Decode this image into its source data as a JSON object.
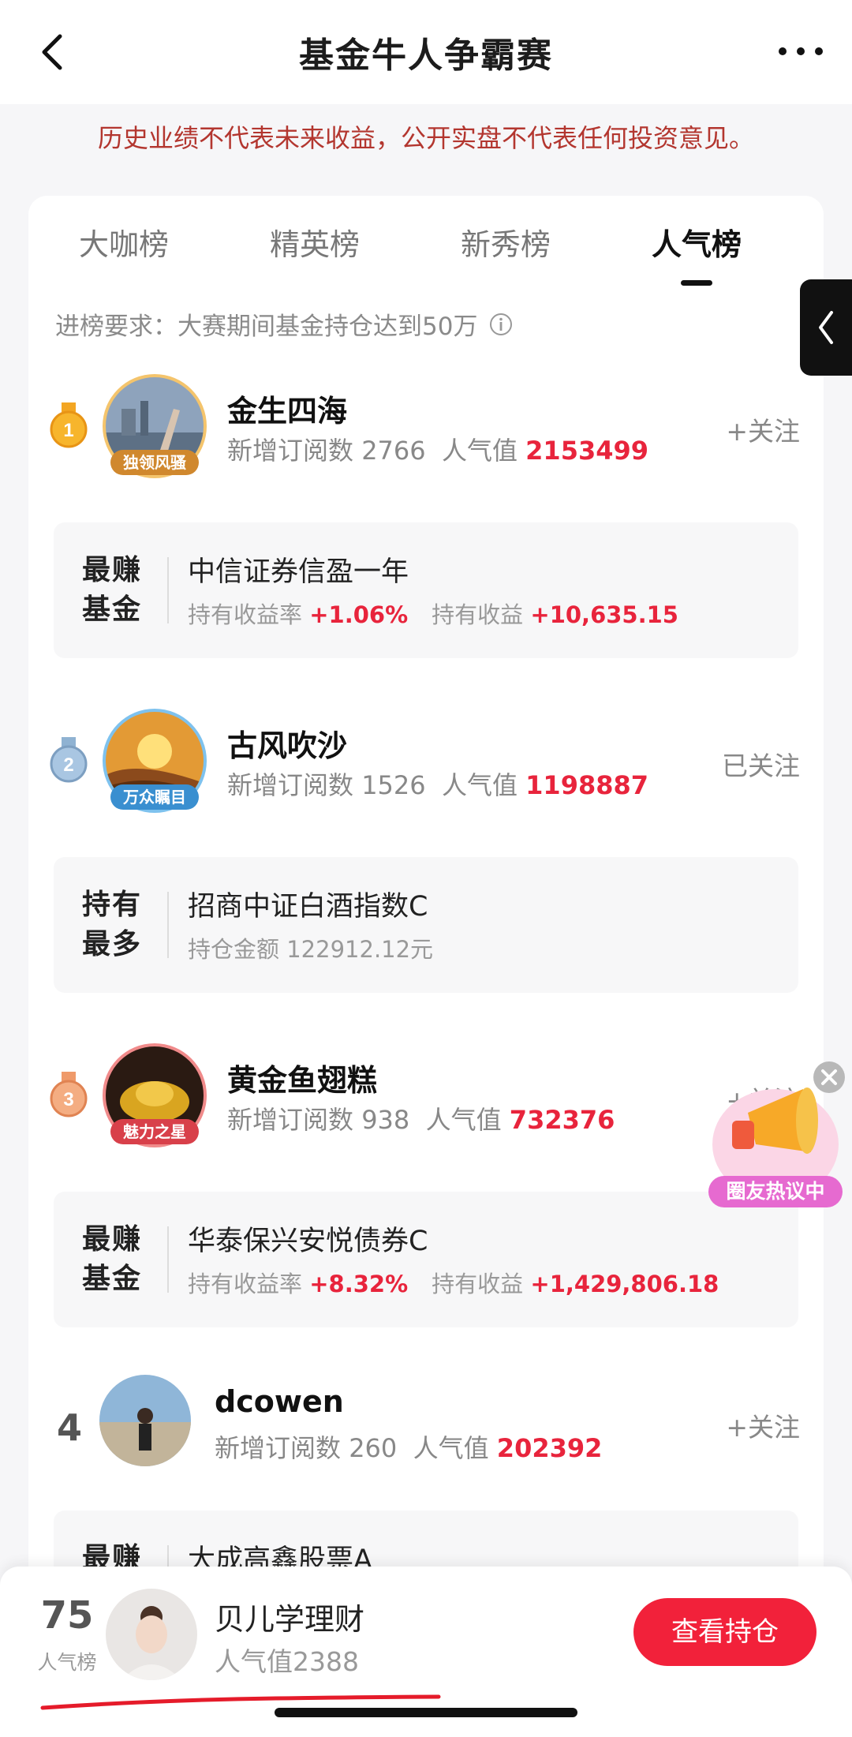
{
  "header": {
    "title": "基金牛人争霸赛"
  },
  "disclaimer": "历史业绩不代表未来收益，公开实盘不代表任何投资意见。",
  "tabs": [
    {
      "label": "大咖榜",
      "active": false
    },
    {
      "label": "精英榜",
      "active": false
    },
    {
      "label": "新秀榜",
      "active": false
    },
    {
      "label": "人气榜",
      "active": true
    }
  ],
  "requirement": "进榜要求：大赛期间基金持仓达到50万",
  "entries": [
    {
      "rank": "1",
      "name": "金生四海",
      "badge": "独领风骚",
      "subs_label": "新增订阅数",
      "subs": "2766",
      "pop_label": "人气值",
      "pop": "2153499",
      "follow": "+关注",
      "fund_label_1": "最赚",
      "fund_label_2": "基金",
      "fund_name": "中信证券信盈一年",
      "detail_a_label": "持有收益率",
      "detail_a_value": "+1.06%",
      "detail_b_label": "持有收益",
      "detail_b_value": "+10,635.15"
    },
    {
      "rank": "2",
      "name": "古风吹沙",
      "badge": "万众瞩目",
      "subs_label": "新增订阅数",
      "subs": "1526",
      "pop_label": "人气值",
      "pop": "1198887",
      "follow": "已关注",
      "fund_label_1": "持有",
      "fund_label_2": "最多",
      "fund_name": "招商中证白酒指数C",
      "detail_a_label": "持仓金额",
      "detail_a_value": "122912.12元"
    },
    {
      "rank": "3",
      "name": "黄金鱼翅糕",
      "badge": "魅力之星",
      "subs_label": "新增订阅数",
      "subs": "938",
      "pop_label": "人气值",
      "pop": "732376",
      "follow": "+关注",
      "fund_label_1": "最赚",
      "fund_label_2": "基金",
      "fund_name": "华泰保兴安悦债券C",
      "detail_a_label": "持有收益率",
      "detail_a_value": "+8.32%",
      "detail_b_label": "持有收益",
      "detail_b_value": "+1,429,806.18"
    },
    {
      "rank": "4",
      "name": "dcowen",
      "subs_label": "新增订阅数",
      "subs": "260",
      "pop_label": "人气值",
      "pop": "202392",
      "follow": "+关注",
      "fund_label_1": "最赚",
      "fund_name": "大成高鑫股票A"
    }
  ],
  "promo": {
    "label": "圈友热议中"
  },
  "me": {
    "rank": "75",
    "rank_label": "人气榜",
    "name": "贝儿学理财",
    "pop": "人气值2388",
    "button": "查看持仓"
  },
  "colors": {
    "accent": "#e8243c",
    "button": "#f2213a",
    "disclaimer": "#b3362f"
  }
}
